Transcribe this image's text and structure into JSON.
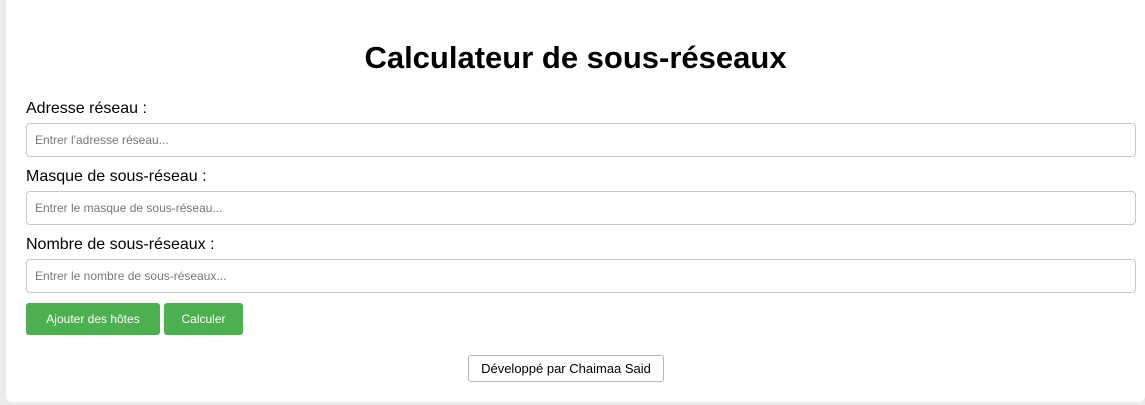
{
  "page": {
    "title": "Calculateur de sous-réseaux"
  },
  "form": {
    "network_address": {
      "label": "Adresse réseau :",
      "value": "",
      "placeholder": "Entrer l'adresse réseau..."
    },
    "subnet_mask": {
      "label": "Masque de sous-réseau :",
      "value": "",
      "placeholder": "Entrer le masque de sous-réseau..."
    },
    "subnet_count": {
      "label": "Nombre de sous-réseaux :",
      "value": "",
      "placeholder": "Entrer le nombre de sous-réseaux..."
    }
  },
  "actions": {
    "add_hosts_label": "Ajouter des hôtes",
    "calculate_label": "Calculer"
  },
  "footer": {
    "credit_label": "Développé par Chaimaa Said"
  },
  "colors": {
    "primary_button": "#4caf50",
    "background": "#ececec",
    "card": "#ffffff"
  }
}
